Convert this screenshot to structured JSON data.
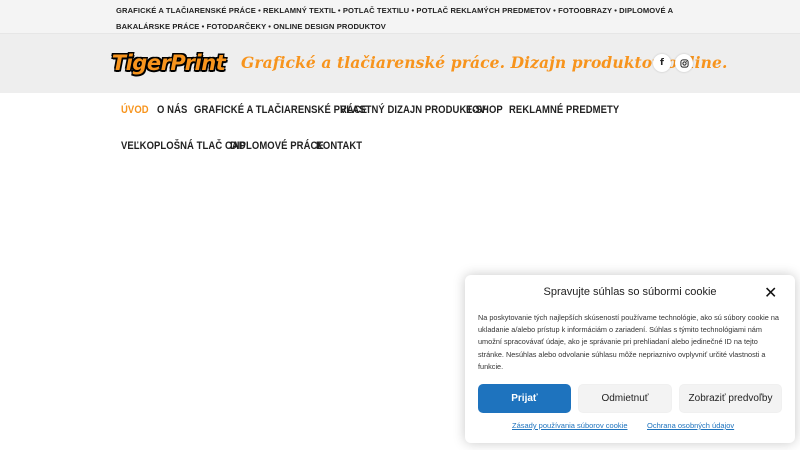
{
  "topbar": {
    "links_text": "GRAFICKÉ A TLAČIARENSKÉ PRÁCE • REKLAMNÝ TEXTIL • POTLAČ TEXTILU • POTLAČ REKLAMÝCH PREDMETOV • FOTOOBRAZY • DIPLOMOVÉ A BAKALÁRSKE PRÁCE • FOTODARČEKY • ONLINE DESIGN PRODUKTOV"
  },
  "header": {
    "logo_text": "TigerPrint",
    "slogan": "Grafické a tlačiarenské práce. Dizajn produktov online.",
    "social": [
      {
        "icon": "facebook-icon",
        "glyph": "f"
      },
      {
        "icon": "instagram-icon",
        "glyph": "◎"
      }
    ]
  },
  "nav": {
    "items": [
      {
        "label": "ÚVOD"
      },
      {
        "label": "O NÁS"
      },
      {
        "label": "GRAFICKÉ A TLAČIARENSKÉ PRÁCE"
      },
      {
        "label": "VLASTNÝ DIZAJN PRODUKTOV"
      },
      {
        "label": "E-SHOP"
      },
      {
        "label": "REKLAMNÉ PREDMETY"
      },
      {
        "label": "VEĽKOPLOŠNÁ TLAČ CAD"
      },
      {
        "label": "DIPLOMOVÉ PRÁCE"
      },
      {
        "label": "KONTAKT"
      }
    ],
    "active_color": "#f7941d"
  },
  "cookie": {
    "title": "Spravujte súhlas so súbormi cookie",
    "close_glyph": "✕",
    "body": "Na poskytovanie tých najlepších skúseností používame technológie, ako sú súbory cookie na ukladanie a/alebo prístup k informáciám o zariadení. Súhlas s týmito technológiami nám umožní spracovávať údaje, ako je správanie pri prehliadaní alebo jedinečné ID na tejto stránke. Nesúhlas alebo odvolanie súhlasu môže nepriaznivo ovplyvniť určité vlastnosti a funkcie.",
    "accept_label": "Prijať",
    "deny_label": "Odmietnuť",
    "prefs_label": "Zobraziť predvoľby",
    "link_policy": "Zásady používania súborov cookie",
    "link_privacy": "Ochrana osobných údajov",
    "accent_color": "#1e73be"
  },
  "brand_color": "#f7941d"
}
